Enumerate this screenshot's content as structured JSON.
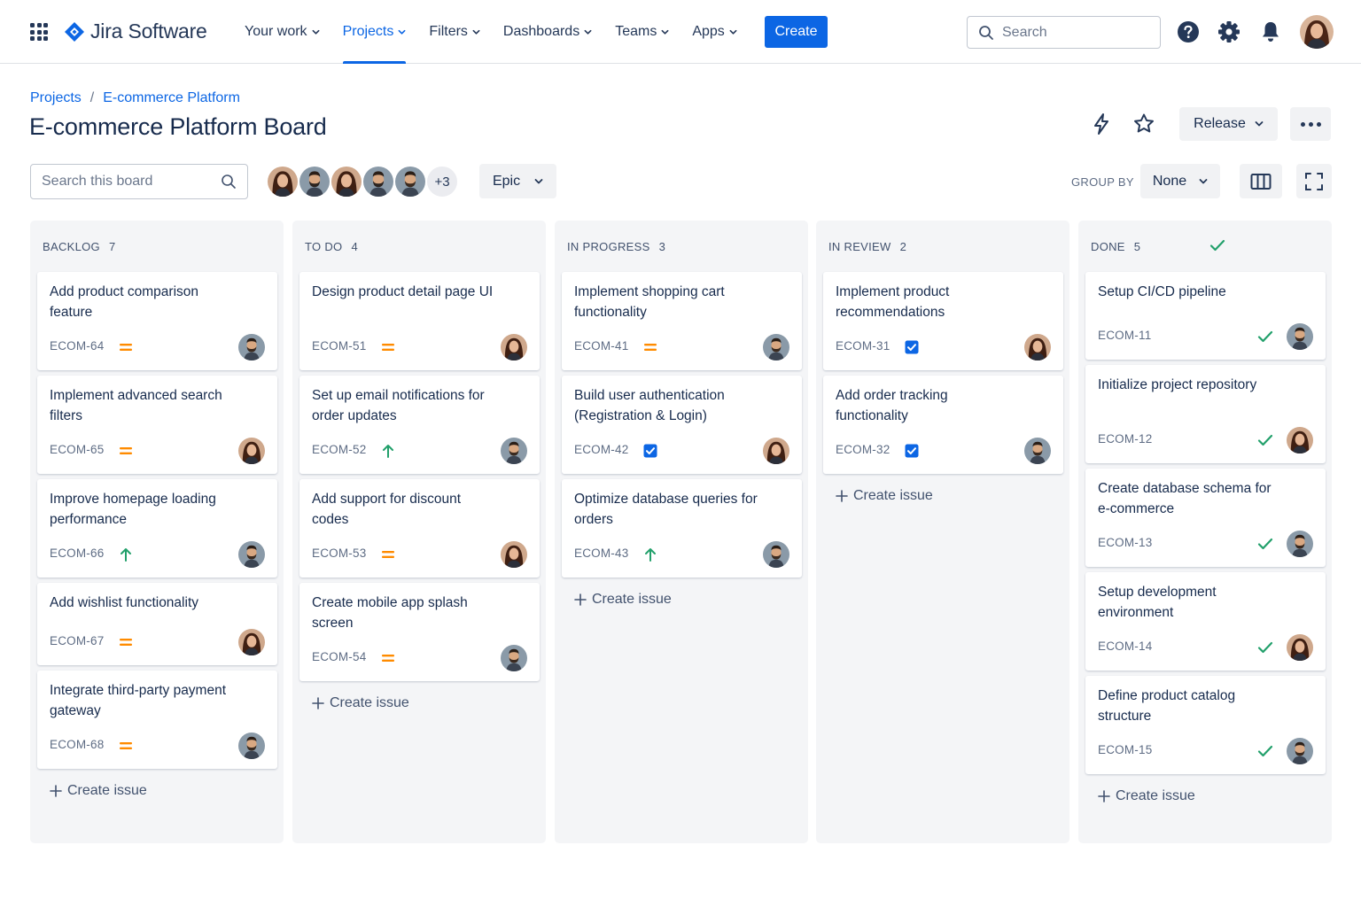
{
  "nav": {
    "product": "Jira Software",
    "items": [
      {
        "label": "Your work",
        "active": false
      },
      {
        "label": "Projects",
        "active": true
      },
      {
        "label": "Filters",
        "active": false
      },
      {
        "label": "Dashboards",
        "active": false
      },
      {
        "label": "Teams",
        "active": false
      },
      {
        "label": "Apps",
        "active": false
      }
    ],
    "create_label": "Create",
    "search_placeholder": "Search",
    "icons": [
      "app-switcher-icon",
      "help-icon",
      "settings-icon",
      "notifications-icon"
    ]
  },
  "breadcrumb": [
    "Projects",
    "E-commerce Platform"
  ],
  "page_title": "E-commerce Platform Board",
  "header_actions": {
    "release_label": "Release",
    "icons": [
      "automation-icon",
      "star-icon",
      "more-icon"
    ]
  },
  "toolbar": {
    "search_placeholder": "Search this board",
    "extra_members": "+3",
    "epic_label": "Epic",
    "group_by_label": "GROUP BY",
    "group_by_value": "None"
  },
  "create_issue_label": "Create issue",
  "colors": {
    "accent": "#0c66e4",
    "medium_priority": "#ff8b00",
    "high_priority": "#22a06b",
    "done_check": "#22a06b"
  },
  "columns": [
    {
      "name": "BACKLOG",
      "count": "7",
      "cards": [
        {
          "title": "Add product comparison feature",
          "key": "ECOM-64",
          "icon": "medium-priority-icon",
          "avatar": "male"
        },
        {
          "title": "Implement advanced search filters",
          "key": "ECOM-65",
          "icon": "medium-priority-icon",
          "avatar": "female"
        },
        {
          "title": "Improve homepage loading performance",
          "key": "ECOM-66",
          "icon": "high-priority-icon",
          "avatar": "male"
        },
        {
          "title": "Add wishlist functionality",
          "key": "ECOM-67",
          "icon": "medium-priority-icon",
          "avatar": "female"
        },
        {
          "title": "Integrate third-party payment gateway",
          "key": "ECOM-68",
          "icon": "medium-priority-icon",
          "avatar": "male"
        }
      ]
    },
    {
      "name": "TO DO",
      "count": "4",
      "cards": [
        {
          "title": "Design product detail page UI",
          "key": "ECOM-51",
          "icon": "medium-priority-icon",
          "avatar": "female"
        },
        {
          "title": "Set up email notifications for order updates",
          "key": "ECOM-52",
          "icon": "high-priority-icon",
          "avatar": "male"
        },
        {
          "title": "Add support for discount codes",
          "key": "ECOM-53",
          "icon": "medium-priority-icon",
          "avatar": "female"
        },
        {
          "title": "Create mobile app splash screen",
          "key": "ECOM-54",
          "icon": "medium-priority-icon",
          "avatar": "male"
        }
      ]
    },
    {
      "name": "IN PROGRESS",
      "count": "3",
      "cards": [
        {
          "title": "Implement shopping cart functionality",
          "key": "ECOM-41",
          "icon": "medium-priority-icon",
          "avatar": "male"
        },
        {
          "title": "Build user authentication (Registration & Login)",
          "key": "ECOM-42",
          "icon": "task-checkbox-icon",
          "avatar": "female"
        },
        {
          "title": "Optimize database queries for orders",
          "key": "ECOM-43",
          "icon": "high-priority-icon",
          "avatar": "male"
        }
      ]
    },
    {
      "name": "IN REVIEW",
      "count": "2",
      "cards": [
        {
          "title": "Implement product recommendations",
          "key": "ECOM-31",
          "icon": "task-checkbox-icon",
          "avatar": "female"
        },
        {
          "title": "Add order tracking functionality",
          "key": "ECOM-32",
          "icon": "task-checkbox-icon",
          "avatar": "male"
        }
      ]
    },
    {
      "name": "DONE",
      "count": "5",
      "done": true,
      "cards": [
        {
          "title": "Setup CI/CD pipeline",
          "key": "ECOM-11",
          "icon": "done-check-icon",
          "avatar": "male"
        },
        {
          "title": "Initialize project repository",
          "key": "ECOM-12",
          "icon": "done-check-icon",
          "avatar": "female"
        },
        {
          "title": "Create database schema for e-commerce",
          "key": "ECOM-13",
          "icon": "done-check-icon",
          "avatar": "male"
        },
        {
          "title": "Setup development environment",
          "key": "ECOM-14",
          "icon": "done-check-icon",
          "avatar": "female"
        },
        {
          "title": "Define product catalog structure",
          "key": "ECOM-15",
          "icon": "done-check-icon",
          "avatar": "male"
        }
      ]
    }
  ]
}
